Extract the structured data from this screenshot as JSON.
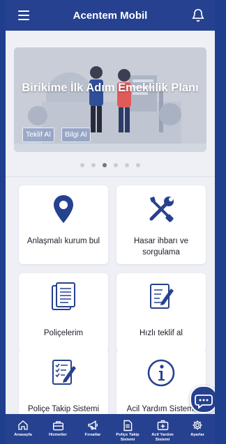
{
  "header": {
    "title": "Acentem Mobil",
    "menu_icon": "hamburger-menu-icon",
    "bell_icon": "bell-icon"
  },
  "banner": {
    "headline": "Birikime İlk Adım Emeklilik Planı",
    "buttons": [
      "Teklif Al",
      "Bilgi Al"
    ],
    "slide_count": 6,
    "active_slide": 3
  },
  "cards": [
    {
      "label": "Anlaşmalı kurum bul",
      "icon": "location-pin-icon"
    },
    {
      "label": "Hasar ihbarı ve sorgulama",
      "icon": "tools-icon"
    },
    {
      "label": "Poliçelerim",
      "icon": "documents-icon"
    },
    {
      "label": "Hızlı teklif al",
      "icon": "edit-document-icon"
    },
    {
      "label": "Poliçe Takip Sistemi",
      "icon": "checklist-pen-icon"
    },
    {
      "label": "Acil Yardım Sistemi",
      "icon": "info-circle-icon"
    }
  ],
  "bottom_nav": [
    {
      "label": "Anasayfa",
      "icon": "home-icon"
    },
    {
      "label": "Hizmetler",
      "icon": "briefcase-icon"
    },
    {
      "label": "Fırsatlar",
      "icon": "megaphone-icon"
    },
    {
      "label": "Poliçe Takip Sistemi",
      "icon": "document-icon"
    },
    {
      "label": "Acil Yardım Sistemi",
      "icon": "first-aid-icon"
    },
    {
      "label": "Ayarlar",
      "icon": "gear-icon"
    }
  ],
  "colors": {
    "primary": "#26418f",
    "icon": "#26418f",
    "page_bg": "#eef0f6"
  }
}
